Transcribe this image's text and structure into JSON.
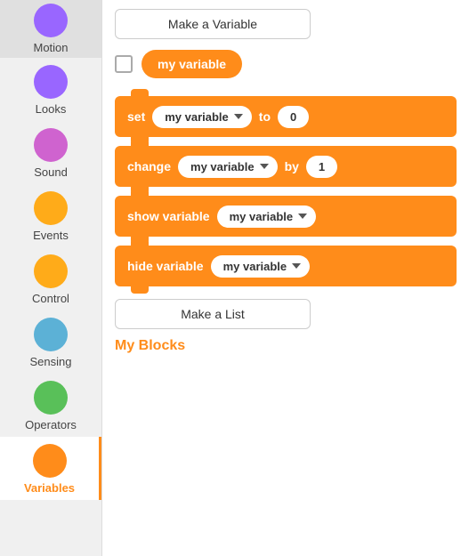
{
  "sidebar": {
    "items": [
      {
        "id": "motion",
        "label": "Motion",
        "color": "circle-purple",
        "active": false
      },
      {
        "id": "looks",
        "label": "Looks",
        "color": "circle-purple",
        "active": false
      },
      {
        "id": "sound",
        "label": "Sound",
        "color": "circle-pink",
        "active": false
      },
      {
        "id": "events",
        "label": "Events",
        "color": "circle-yellow",
        "active": false
      },
      {
        "id": "control",
        "label": "Control",
        "color": "circle-orange",
        "active": false
      },
      {
        "id": "sensing",
        "label": "Sensing",
        "color": "circle-blue",
        "active": false
      },
      {
        "id": "operators",
        "label": "Operators",
        "color": "circle-green",
        "active": false
      },
      {
        "id": "variables",
        "label": "Variables",
        "color": "circle-orange2",
        "active": true
      }
    ]
  },
  "main": {
    "make_variable_label": "Make a Variable",
    "my_variable_label": "my variable",
    "blocks": [
      {
        "id": "set",
        "parts": [
          "set",
          "dropdown:my variable",
          "to",
          "value:0"
        ]
      },
      {
        "id": "change",
        "parts": [
          "change",
          "dropdown:my variable",
          "by",
          "value:1"
        ]
      },
      {
        "id": "show",
        "parts": [
          "show variable",
          "dropdown:my variable"
        ]
      },
      {
        "id": "hide",
        "parts": [
          "hide variable",
          "dropdown:my variable"
        ]
      }
    ],
    "make_list_label": "Make a List",
    "my_blocks_label": "My Blocks"
  }
}
